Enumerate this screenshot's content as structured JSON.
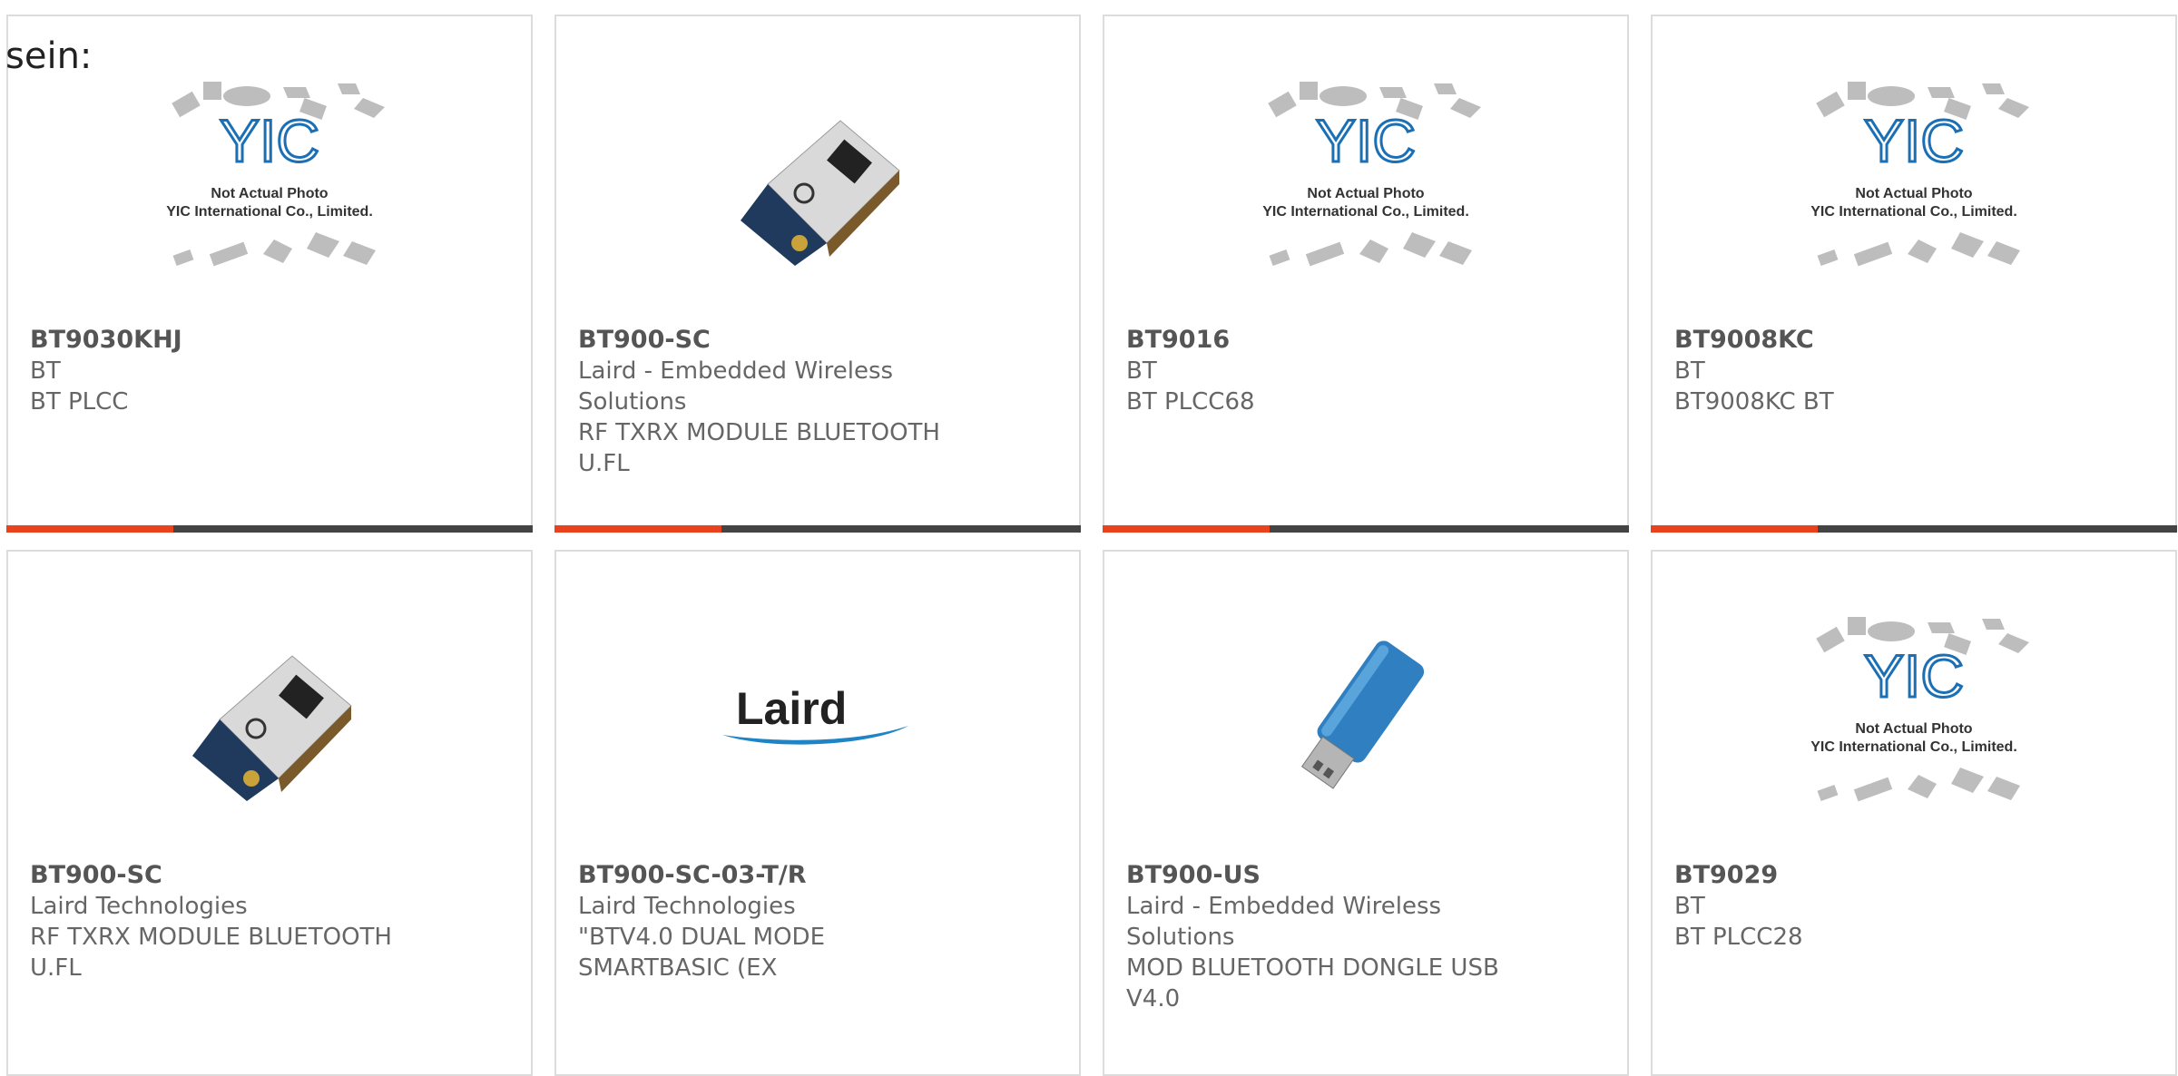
{
  "intro": "sein:",
  "products": [
    {
      "part": "BT9030KHJ",
      "maker": "BT",
      "desc": "BT PLCC",
      "image": "yic-placeholder"
    },
    {
      "part": "BT900-SC",
      "maker": "Laird - Embedded Wireless Solutions",
      "desc": "RF TXRX MODULE BLUETOOTH U.FL",
      "image": "bluetooth-module"
    },
    {
      "part": "BT9016",
      "maker": "BT",
      "desc": "BT PLCC68",
      "image": "yic-placeholder"
    },
    {
      "part": "BT9008KC",
      "maker": "BT",
      "desc": "BT9008KC BT",
      "image": "yic-placeholder"
    },
    {
      "part": "BT900-SC",
      "maker": "Laird Technologies",
      "desc": "RF TXRX MODULE BLUETOOTH U.FL",
      "image": "bluetooth-module"
    },
    {
      "part": "BT900-SC-03-T/R",
      "maker": "Laird Technologies",
      "desc": "\"BTV4.0 DUAL MODE SMARTBASIC (EX",
      "image": "laird-logo"
    },
    {
      "part": "BT900-US",
      "maker": "Laird - Embedded Wireless Solutions",
      "desc": "MOD BLUETOOTH DONGLE USB V4.0",
      "image": "usb-dongle"
    },
    {
      "part": "BT9029",
      "maker": "BT",
      "desc": "BT PLCC28",
      "image": "yic-placeholder"
    }
  ],
  "placeholder": {
    "brand": "YIC",
    "line1": "Not Actual Photo",
    "line2": "YIC International Co., Limited."
  },
  "laird_logo_text": "Laird",
  "colors": {
    "accent": "#e8431c",
    "bar": "#444444",
    "border": "#dcdcdc"
  }
}
